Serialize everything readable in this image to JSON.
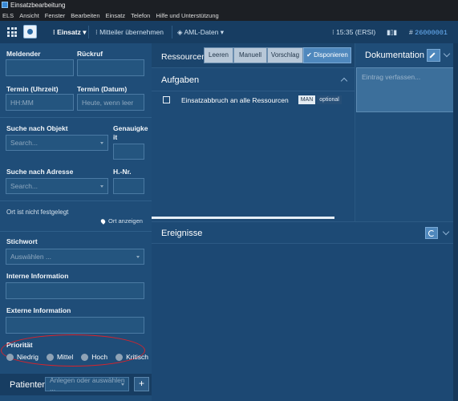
{
  "window": {
    "title": "Einsatzbearbeitung"
  },
  "menu": [
    "ELS",
    "Ansicht",
    "Fenster",
    "Bearbeiten",
    "Einsatz",
    "Telefon",
    "Hilfe und Unterstützung"
  ],
  "toolbar": {
    "einsatz_label": "Einsatz",
    "mitteiler_label": "Mitteiler übernehmen",
    "aml_label": "AML-Daten",
    "time_label": "15:35 (ERSI)",
    "id_label": "26000001"
  },
  "form": {
    "meldender_label": "Meldender",
    "rueckruf_label": "Rückruf",
    "termin_uhrzeit_label": "Termin (Uhrzeit)",
    "termin_uhrzeit_placeholder": "HH:MM",
    "termin_datum_label": "Termin (Datum)",
    "termin_datum_placeholder": "Heute, wenn leer",
    "suche_objekt_label": "Suche nach Objekt",
    "suche_objekt_placeholder": "Search...",
    "genauigkeit_label_1": "Genauigke",
    "genauigkeit_label_2": "it",
    "suche_adresse_label": "Suche nach Adresse",
    "suche_adresse_placeholder": "Search...",
    "hnr_label": "H.-Nr.",
    "ort_note": "Ort ist nicht festgelegt",
    "ort_anzeigen": "Ort anzeigen",
    "stichwort_label": "Stichwort",
    "stichwort_placeholder": "Auswählen ...",
    "interne_label": "Interne Information",
    "externe_label": "Externe Information",
    "prioritaet_label": "Priorität",
    "prioritaet_options": [
      "Niedrig",
      "Mittel",
      "Hoch",
      "Kritisch"
    ]
  },
  "patienten": {
    "label": "Patienten",
    "placeholder": "Anlegen oder auswählen ..."
  },
  "ressourcen": {
    "title": "Ressourcen",
    "buttons": [
      "Leeren",
      "Manuell",
      "Vorschlag",
      "Disponieren"
    ]
  },
  "aufgaben": {
    "title": "Aufgaben",
    "tasks": [
      {
        "text": "Einsatzabbruch an alle Ressourcen",
        "tag": "MAN",
        "tag2": "optional"
      }
    ]
  },
  "dokumentation": {
    "title": "Dokumentation",
    "placeholder": "Eintrag verfassen..."
  },
  "ereignisse": {
    "title": "Ereignisse"
  },
  "colors": {
    "panel_bg": "#1f4d78",
    "toolbar_bg": "#173d62",
    "accent": "#4f88bd",
    "highlight": "#d9232b"
  }
}
